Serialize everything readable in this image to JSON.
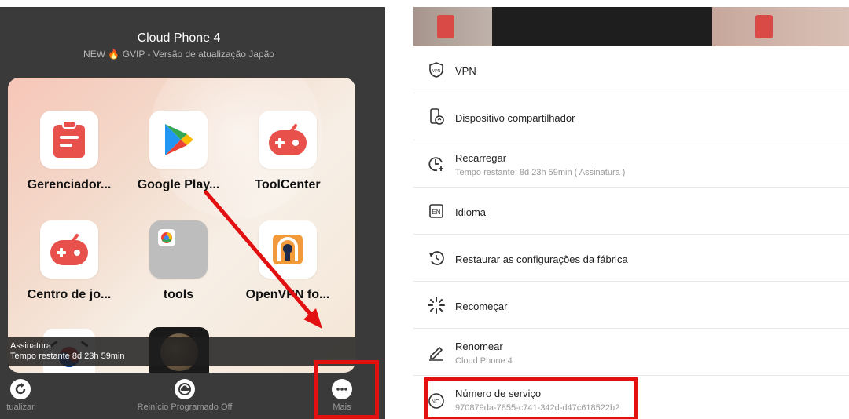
{
  "left": {
    "title": "Cloud Phone 4",
    "subtitle_prefix": "NEW",
    "subtitle_suffix": "GVIP - Versão de atualização Japão",
    "apps": [
      {
        "name": "Gerenciador...",
        "icon": "clipboard-icon"
      },
      {
        "name": "Google Play...",
        "icon": "google-play-icon"
      },
      {
        "name": "ToolCenter",
        "icon": "gamepad-icon"
      },
      {
        "name": "Centro de jo...",
        "icon": "gamepad-icon"
      },
      {
        "name": "tools",
        "icon": "folder-icon"
      },
      {
        "name": "OpenVPN fo...",
        "icon": "openvpn-icon"
      }
    ],
    "status_line1": "Assinatura",
    "status_line2": "Tempo restante 8d 23h 59min",
    "toolbar": {
      "refresh_label": "tualizar",
      "schedule_label": "Reinício Programado Off",
      "more_label": "Mais"
    }
  },
  "menu": {
    "items": [
      {
        "label": "VPN",
        "icon": "vpn-icon"
      },
      {
        "label": "Dispositivo compartilhador",
        "icon": "share-device-icon"
      },
      {
        "label": "Recarregar",
        "sub": "Tempo restante: 8d 23h 59min ( Assinatura )",
        "icon": "recharge-clock-icon"
      },
      {
        "label": "Idioma",
        "icon": "language-icon"
      },
      {
        "label": "Restaurar as configurações da fábrica",
        "icon": "factory-reset-icon"
      },
      {
        "label": "Recomeçar",
        "icon": "restart-icon"
      },
      {
        "label": "Renomear",
        "sub": "Cloud Phone 4",
        "icon": "pencil-icon"
      },
      {
        "label": "Número de serviço",
        "sub": "970879da-7855-c741-342d-d47c618522b2",
        "icon": "number-icon"
      }
    ]
  },
  "colors": {
    "highlight": "#e21010",
    "dark_panel": "#3a3a3a",
    "app_red": "#e8514b"
  }
}
